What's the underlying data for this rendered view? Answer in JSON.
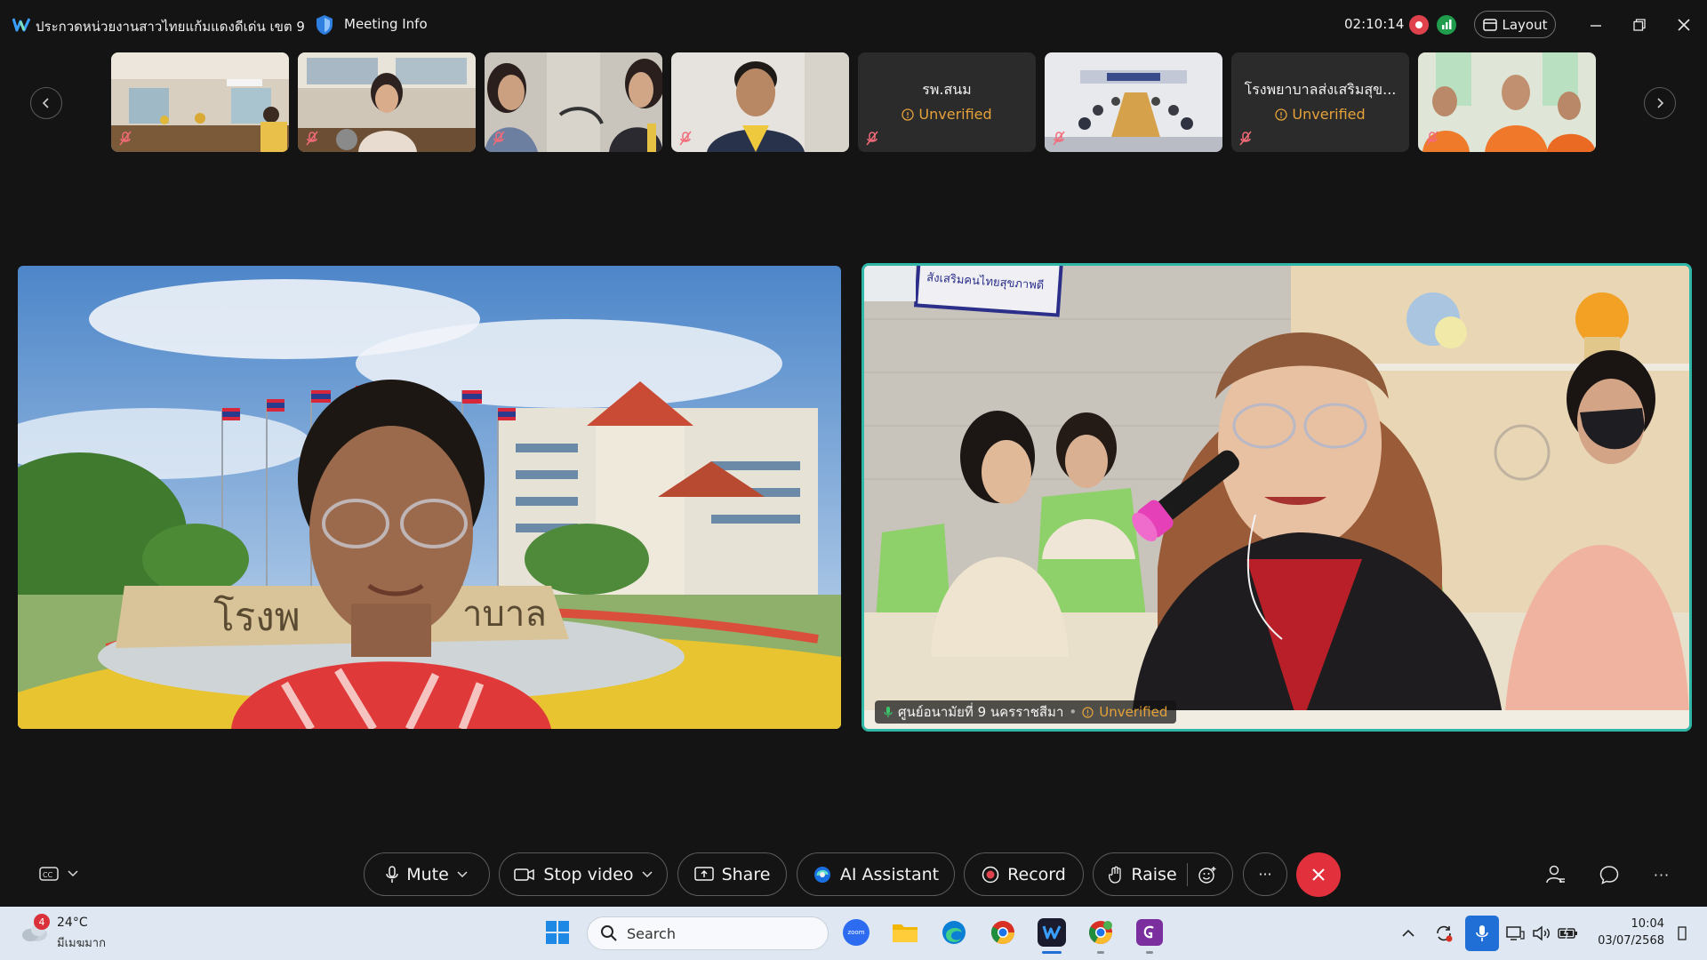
{
  "title_bar": {
    "meeting_title": "ประกวดหน่วยงานสาวไทยแก้มแดงดีเด่น เขต 9",
    "meeting_info_label": "Meeting Info",
    "timer": "02:10:14",
    "layout_label": "Layout"
  },
  "thumbnails": [
    {
      "name": "",
      "unverified": "",
      "muted": true,
      "scene": "office-room"
    },
    {
      "name": "",
      "unverified": "",
      "muted": true,
      "scene": "woman-desk"
    },
    {
      "name": "",
      "unverified": "",
      "muted": true,
      "scene": "two-people"
    },
    {
      "name": "",
      "unverified": "",
      "muted": true,
      "scene": "man-yellow-shirt"
    },
    {
      "name": "รพ.สนม",
      "unverified": "Unverified",
      "muted": true,
      "scene": "no-video"
    },
    {
      "name": "",
      "unverified": "",
      "muted": true,
      "scene": "meeting-room"
    },
    {
      "name": "โรงพยาบาลส่งเสริมสุข...",
      "unverified": "Unverified",
      "muted": true,
      "scene": "no-video"
    },
    {
      "name": "",
      "unverified": "",
      "muted": true,
      "scene": "group-orange"
    }
  ],
  "main_videos": {
    "right_name": "ศูนย์อนามัยที่ 9 นครราชสีมา",
    "right_unverified": "Unverified",
    "right_sign_text": "สังเสริมคนไทยสุขภาพดี"
  },
  "controls": {
    "mute": "Mute",
    "stop_video": "Stop video",
    "share": "Share",
    "ai_assistant": "AI Assistant",
    "record": "Record",
    "raise": "Raise",
    "more": "···"
  },
  "taskbar": {
    "weather_badge": "4",
    "temperature": "24°C",
    "condition": "มีเมฆมาก",
    "search_placeholder": "Search",
    "zoom_label": "zoom",
    "time": "10:04",
    "date": "03/07/2568"
  },
  "colors": {
    "active_speaker_border": "#2fb7a8",
    "unverified": "#e5a23a",
    "end_call": "#e2313c",
    "record_indicator": "#e0424d",
    "signal_indicator": "#1f9d4c"
  }
}
